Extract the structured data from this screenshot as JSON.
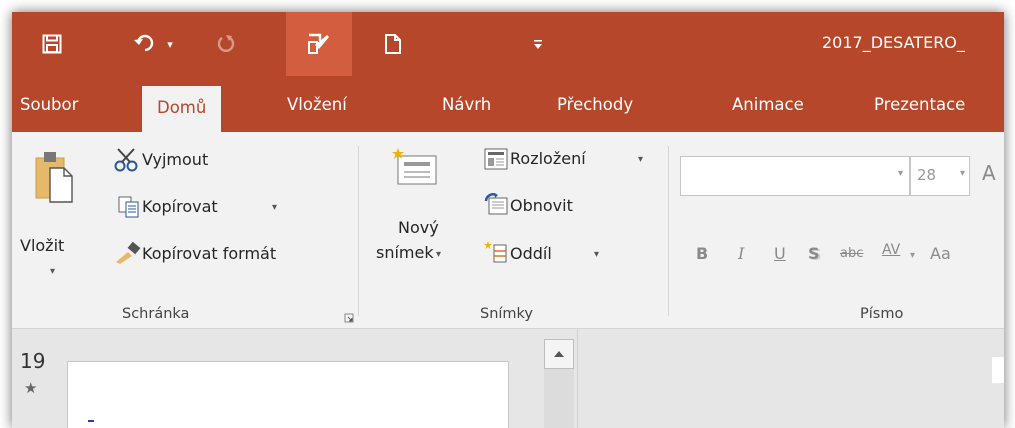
{
  "window": {
    "doc_title": "2017_DESATERO_"
  },
  "quick_access": {
    "save_icon": "save-icon",
    "undo_icon": "undo-icon",
    "undo_dropdown": "▾",
    "redo_icon": "redo-icon",
    "touch_mode_icon": "touch-mode-icon",
    "new_icon": "new-document-icon",
    "customize_icon": "customize-qat-icon"
  },
  "tabs": [
    {
      "label": "Soubor"
    },
    {
      "label": "Domů"
    },
    {
      "label": "Vložení"
    },
    {
      "label": "Návrh"
    },
    {
      "label": "Přechody"
    },
    {
      "label": "Animace"
    },
    {
      "label": "Prezentace"
    }
  ],
  "clipboard": {
    "paste": "Vložit",
    "cut": "Vyjmout",
    "copy": "Kopírovat",
    "format_painter": "Kopírovat formát",
    "group": "Schránka"
  },
  "slides": {
    "new_slide_line1": "Nový",
    "new_slide_line2": "snímek",
    "layout": "Rozložení",
    "reset": "Obnovit",
    "section": "Oddíl",
    "group": "Snímky"
  },
  "font": {
    "font_name": "",
    "font_size": "28",
    "grow": "A",
    "bold": "B",
    "italic": "I",
    "underline": "U",
    "shadow": "S",
    "strikethrough": "abc",
    "spacing": "AV",
    "case": "Aa",
    "group": "Písmo"
  },
  "thumbnails": {
    "slide_number": "19",
    "star": "★"
  },
  "colors": {
    "accent": "#b7472a",
    "active_qa": "#d35e3f"
  }
}
